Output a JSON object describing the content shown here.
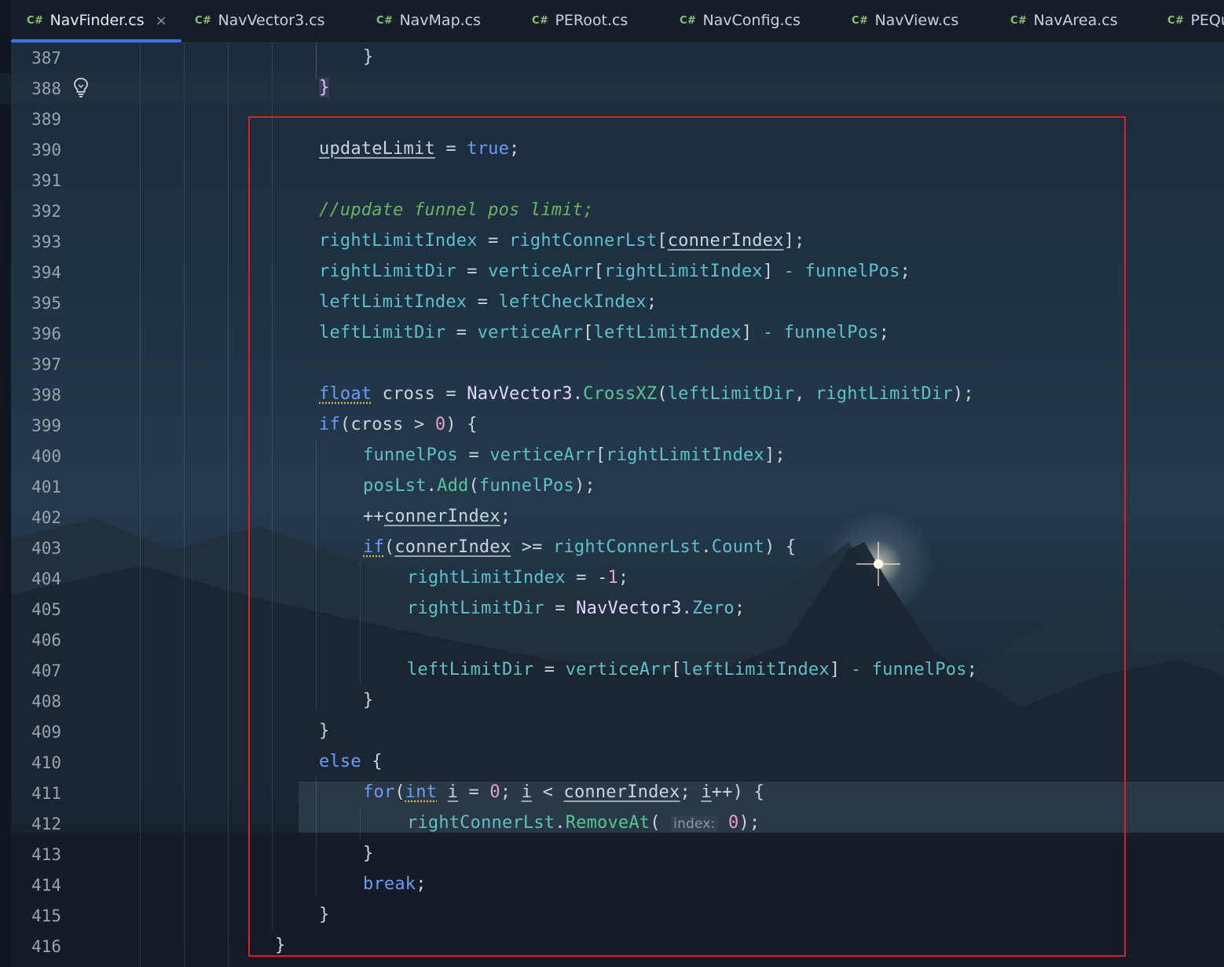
{
  "tabs": [
    {
      "lang": "C#",
      "name": "NavFinder.cs",
      "active": true,
      "close": "×"
    },
    {
      "lang": "C#",
      "name": "NavVector3.cs"
    },
    {
      "lang": "C#",
      "name": "NavMap.cs"
    },
    {
      "lang": "C#",
      "name": "PERoot.cs"
    },
    {
      "lang": "C#",
      "name": "NavConfig.cs"
    },
    {
      "lang": "C#",
      "name": "NavView.cs"
    },
    {
      "lang": "C#",
      "name": "NavArea.cs"
    },
    {
      "lang": "C#",
      "name": "PEQu"
    }
  ],
  "editor": {
    "current_line": "388",
    "intention_icon": "lightbulb-icon",
    "line_numbers": [
      "387",
      "388",
      "389",
      "390",
      "391",
      "392",
      "393",
      "394",
      "395",
      "396",
      "397",
      "398",
      "399",
      "400",
      "401",
      "402",
      "403",
      "404",
      "405",
      "406",
      "407",
      "408",
      "409",
      "410",
      "411",
      "412",
      "413",
      "414",
      "415",
      "416"
    ],
    "code_lines": [
      "}",
      "}",
      "",
      "updateLimit = true;",
      "",
      "//update funnel pos limit;",
      "rightLimitIndex = rightConnerLst[connerIndex];",
      "rightLimitDir = verticeArr[rightLimitIndex] - funnelPos;",
      "leftLimitIndex = leftCheckIndex;",
      "leftLimitDir = verticeArr[leftLimitIndex] - funnelPos;",
      "",
      "float cross = NavVector3.CrossXZ(leftLimitDir, rightLimitDir);",
      "if(cross > 0) {",
      "funnelPos = verticeArr[rightLimitIndex];",
      "posLst.Add(funnelPos);",
      "++connerIndex;",
      "if(connerIndex >= rightConnerLst.Count) {",
      "rightLimitIndex = -1;",
      "rightLimitDir = NavVector3.Zero;",
      "",
      "leftLimitDir = verticeArr[leftLimitIndex] - funnelPos;",
      "}",
      "}",
      "else {",
      "for(int i = 0; i < connerIndex; i++) {",
      "rightConnerLst.RemoveAt( index: 0);",
      "}",
      "break;",
      "}",
      "}"
    ],
    "parameter_hint": "index:"
  },
  "colors": {
    "keyword": "#6c9bf5",
    "field": "#5fc0c8",
    "class": "#e3d7ff",
    "method": "#59c59c",
    "number": "#e8a1c4",
    "comment": "#6fb35f",
    "annotation_box": "#e02020",
    "tab_indicator": "#3574f0"
  }
}
